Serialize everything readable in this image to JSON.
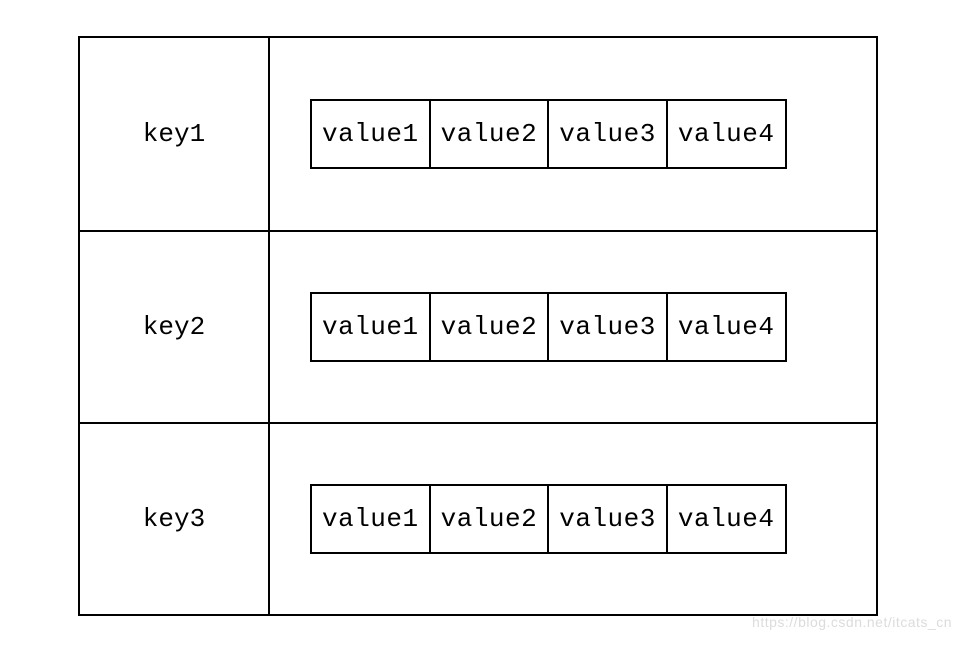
{
  "rows": [
    {
      "key": "key1",
      "values": [
        "value1",
        "value2",
        "value3",
        "value4"
      ]
    },
    {
      "key": "key2",
      "values": [
        "value1",
        "value2",
        "value3",
        "value4"
      ]
    },
    {
      "key": "key3",
      "values": [
        "value1",
        "value2",
        "value3",
        "value4"
      ]
    }
  ],
  "watermark": "https://blog.csdn.net/itcats_cn"
}
